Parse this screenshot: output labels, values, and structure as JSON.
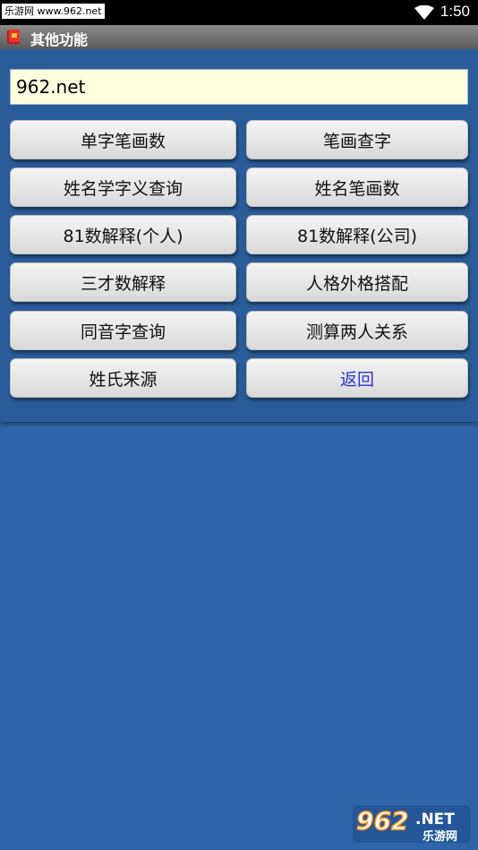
{
  "status_bar": {
    "watermark": "乐游网 www.962.net",
    "time": "1:50"
  },
  "title_bar": {
    "title": "其他功能",
    "icon": "book-icon"
  },
  "url_field": {
    "value": "962.net"
  },
  "buttons": [
    {
      "label": "单字笔画数"
    },
    {
      "label": "笔画查字"
    },
    {
      "label": "姓名学字义查询"
    },
    {
      "label": "姓名笔画数"
    },
    {
      "label": "81数解释(个人)"
    },
    {
      "label": "81数解释(公司)"
    },
    {
      "label": "三才数解释"
    },
    {
      "label": "人格外格搭配"
    },
    {
      "label": "同音字查询"
    },
    {
      "label": "测算两人关系"
    },
    {
      "label": "姓氏来源"
    },
    {
      "label": "返回"
    }
  ],
  "logo": {
    "top": "962",
    "suffix": ".NET",
    "sub": "乐游网"
  },
  "colors": {
    "background": "#2f65a8",
    "back_button_text": "#2a36d6",
    "input_bg": "#ffffe0"
  }
}
